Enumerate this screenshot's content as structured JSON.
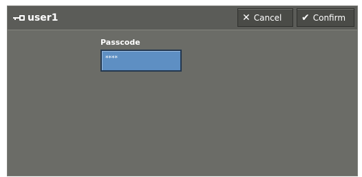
{
  "header": {
    "user_icon": "key-icon",
    "user_name": "user1",
    "cancel_icon": "x-icon",
    "cancel_label": "Cancel",
    "confirm_icon": "checkmark-icon",
    "confirm_label": "Confirm"
  },
  "passcode": {
    "label": "Passcode",
    "value": "****"
  },
  "colors": {
    "background": "#6b6c67",
    "titlebar": "#5b5c58",
    "button": "#4a4b47",
    "field": "#5e8fc3"
  }
}
